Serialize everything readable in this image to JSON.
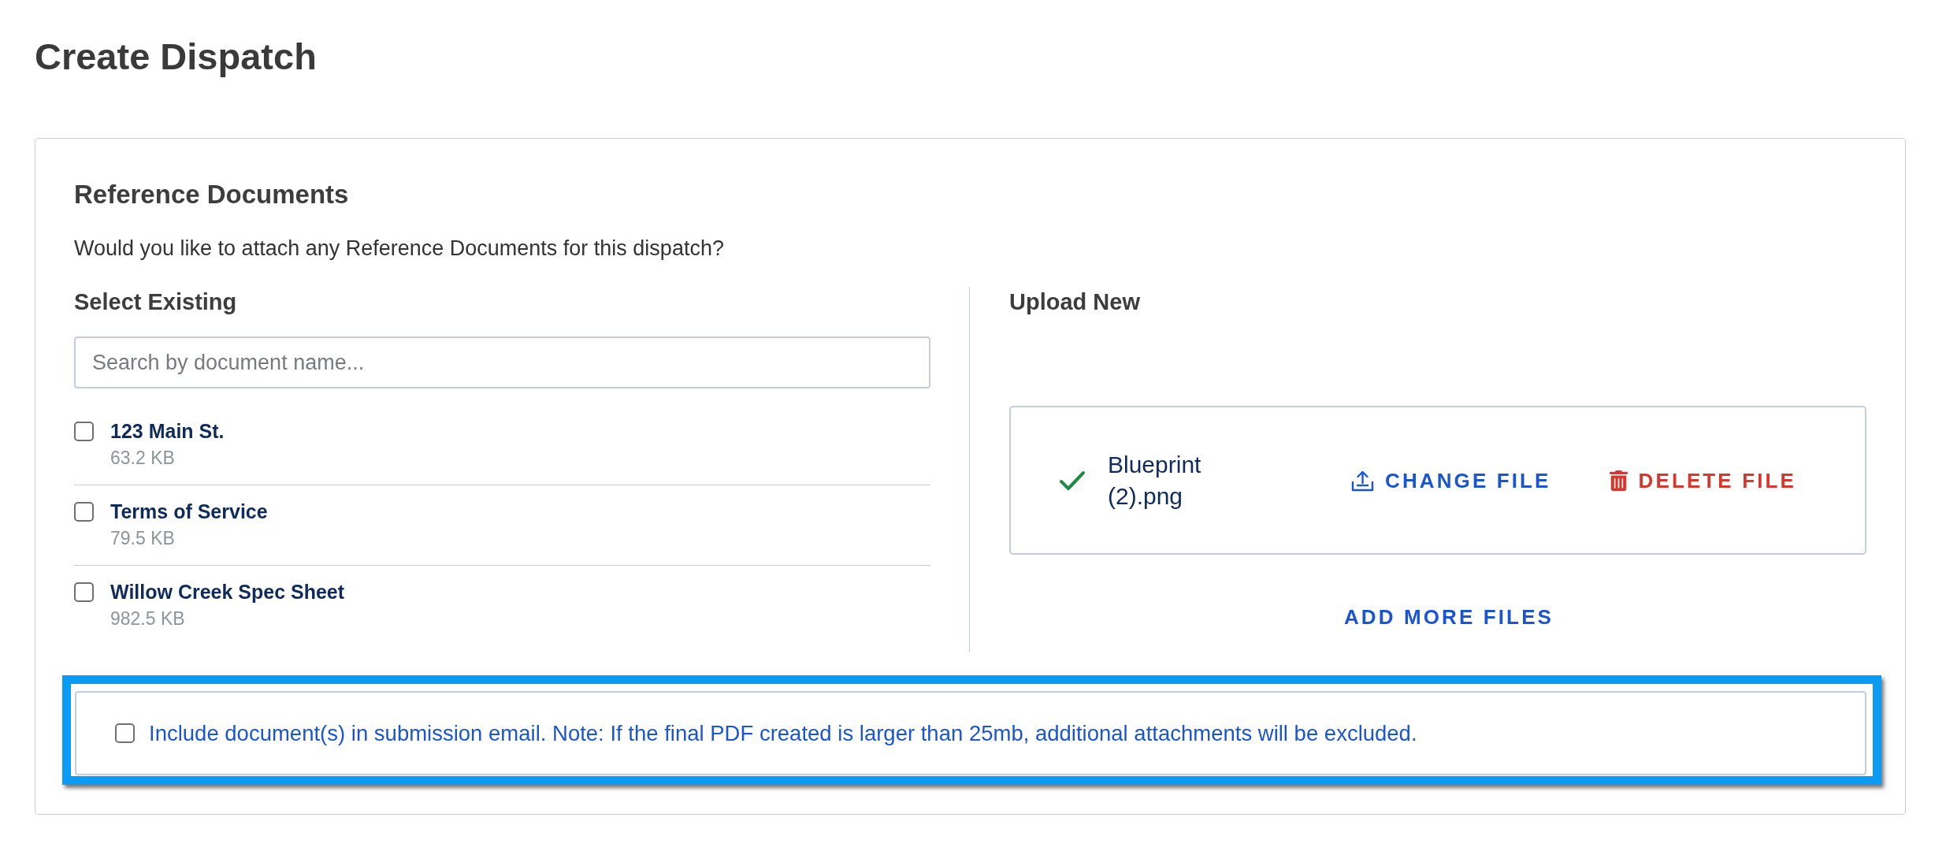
{
  "page": {
    "title": "Create Dispatch"
  },
  "reference_documents": {
    "title": "Reference Documents",
    "prompt": "Would you like to attach any Reference Documents for this dispatch?",
    "select_existing": {
      "heading": "Select Existing",
      "search": {
        "placeholder": "Search by document name..."
      },
      "documents": [
        {
          "name": "123 Main St.",
          "size": "63.2 KB",
          "checked": false
        },
        {
          "name": "Terms of Service",
          "size": "79.5 KB",
          "checked": false
        },
        {
          "name": "Willow Creek Spec Sheet",
          "size": "982.5 KB",
          "checked": false
        }
      ]
    },
    "upload_new": {
      "heading": "Upload New",
      "files": [
        {
          "name": "Blueprint (2).png",
          "actions": [
            {
              "label": "CHANGE FILE",
              "kind": "change"
            },
            {
              "label": "DELETE FILE",
              "kind": "delete"
            }
          ]
        }
      ],
      "add_more": "ADD MORE FILES"
    },
    "email_option": {
      "label": "Include document(s) in submission email. Note: If the final PDF created is larger than 25mb, additional attachments will be excluded.",
      "checked": false,
      "highlighted": true
    }
  }
}
